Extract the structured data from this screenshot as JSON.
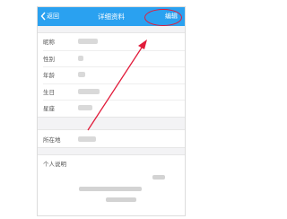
{
  "navbar": {
    "back_label": "返回",
    "title": "详细资料",
    "edit_label": "编辑"
  },
  "profile": {
    "fields": [
      {
        "label": "昵称"
      },
      {
        "label": "性别"
      },
      {
        "label": "年龄"
      },
      {
        "label": "生日"
      },
      {
        "label": "星座"
      }
    ],
    "location_label": "所在地",
    "intro_label": "个人说明"
  },
  "colors": {
    "navbar": "#2aa1f0",
    "annotation": "#e11b3a"
  }
}
